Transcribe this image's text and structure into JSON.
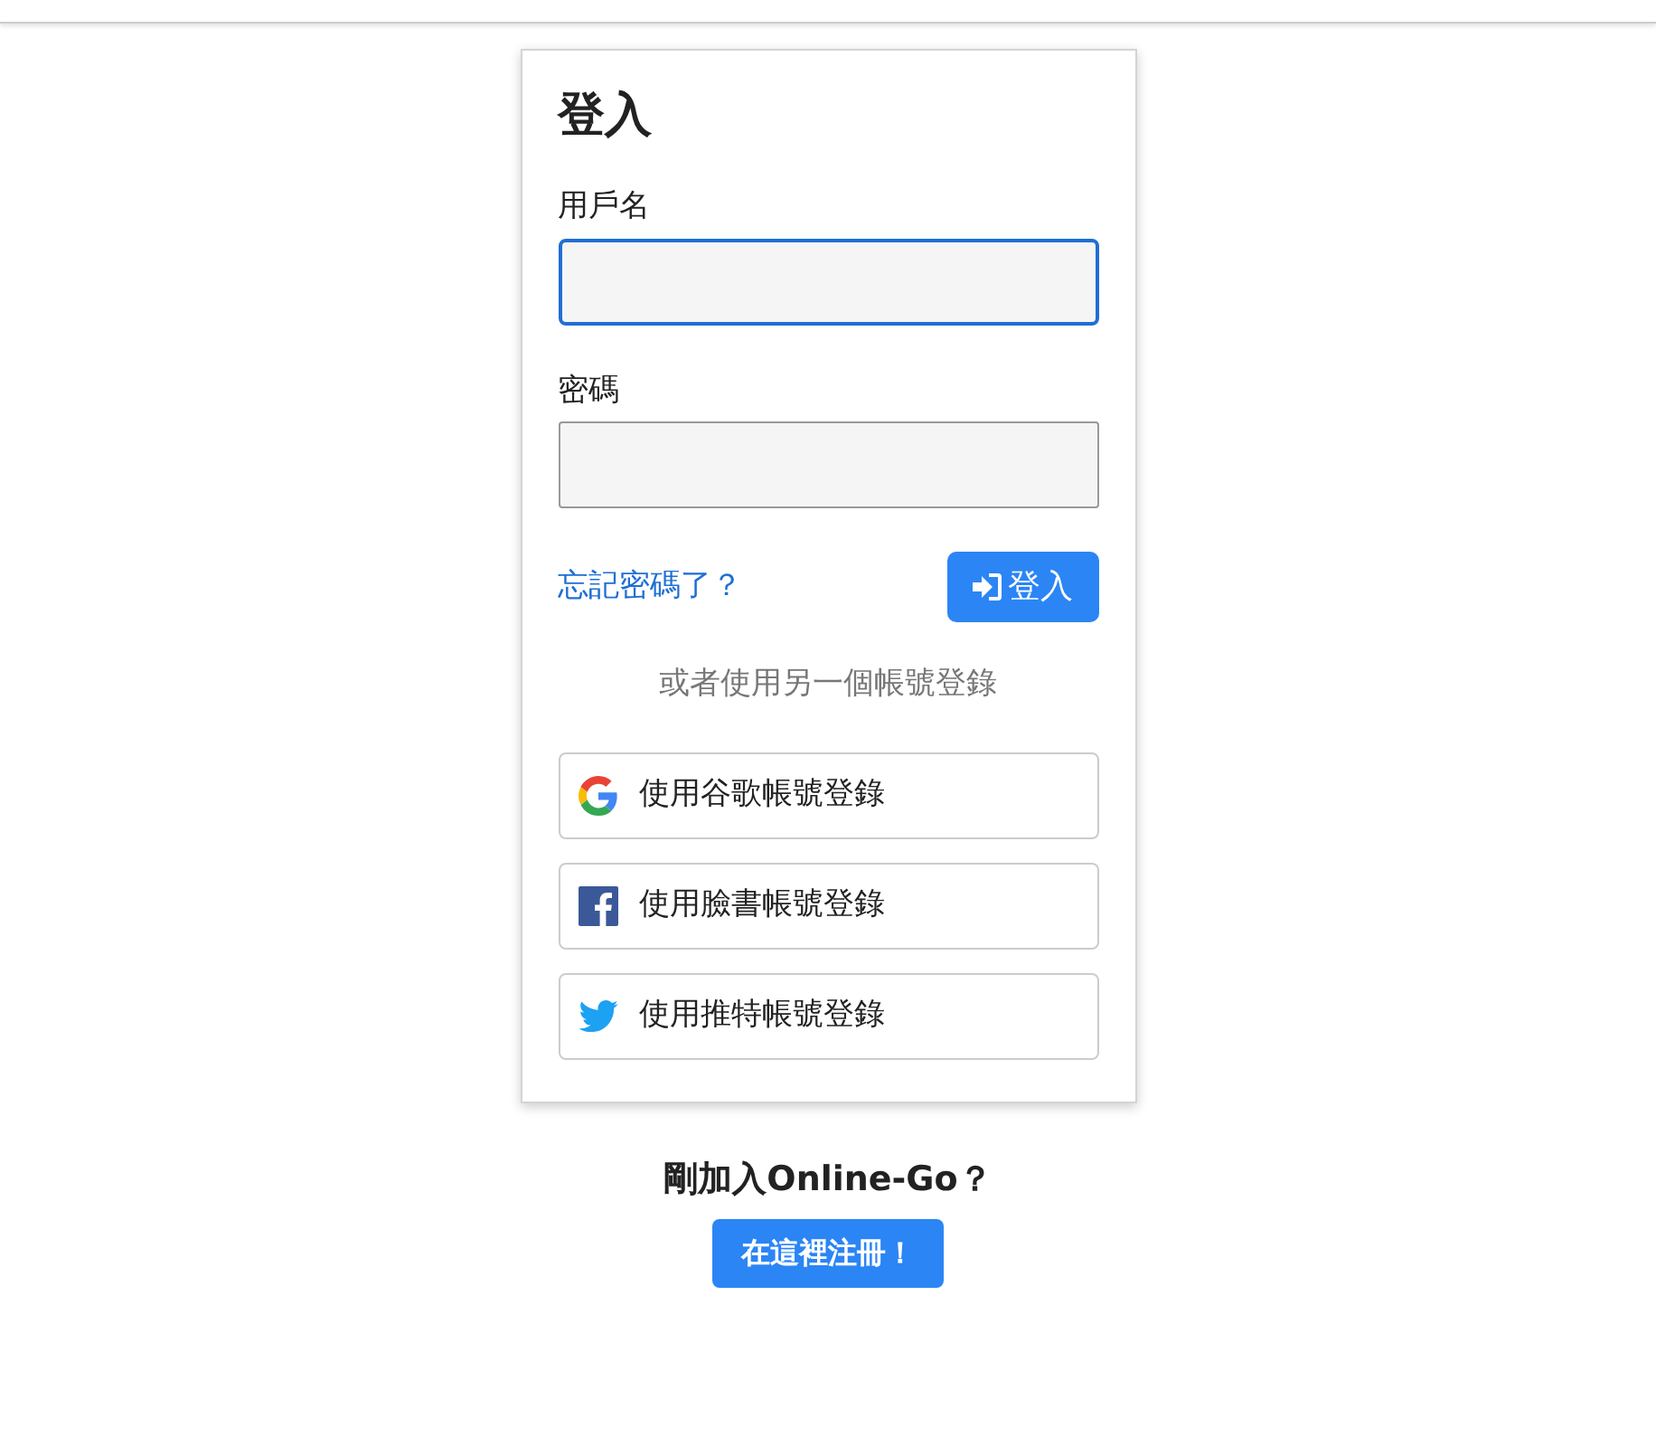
{
  "login": {
    "title": "登入",
    "fields": [
      {
        "label": "用戶名",
        "focused": true
      },
      {
        "label": "密碼",
        "focused": false
      }
    ],
    "forgot_link": "忘記密碼了？",
    "submit_button": "登入",
    "alternative_text": "或者使用另一個帳號登錄",
    "social_buttons": [
      {
        "kind": "google",
        "label": "使用谷歌帳號登錄"
      },
      {
        "kind": "facebook",
        "label": "使用臉書帳號登錄"
      },
      {
        "kind": "twitter",
        "label": "使用推特帳號登錄"
      }
    ]
  },
  "register": {
    "prompt": "剛加入Online-Go？",
    "button": "在這裡注冊！"
  }
}
